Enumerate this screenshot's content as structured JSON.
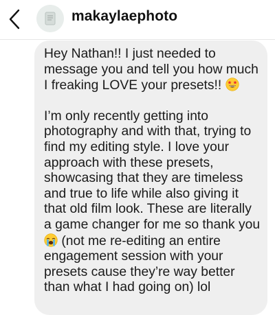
{
  "header": {
    "username": "makaylaephoto",
    "back_icon": "chevron-left-icon",
    "avatar_icon": "profile-avatar-icon"
  },
  "message": {
    "paragraph1": "Hey Nathan!! I just needed to\nmessage you and tell you how much\nI freaking LOVE your presets!!",
    "emoji1": "star-struck-emoji",
    "paragraph2_part1": "I’m only recently getting into\nphotography and with that, trying to\nfind my editing style. I love your\napproach with these presets,\nshowcasing that they are timeless\nand true to life while also giving it\nthat old film look. These are literally\na game changer for me so thank you",
    "emoji2": "loudly-crying-emoji",
    "paragraph2_part2": " (not me re-editing an entire\nengagement session with your\npresets cause they’re way better\nthan what I had going on) lol"
  },
  "colors": {
    "bubble": "#efefef",
    "text": "#1a1a1a",
    "header_border": "#e6e6e6"
  }
}
